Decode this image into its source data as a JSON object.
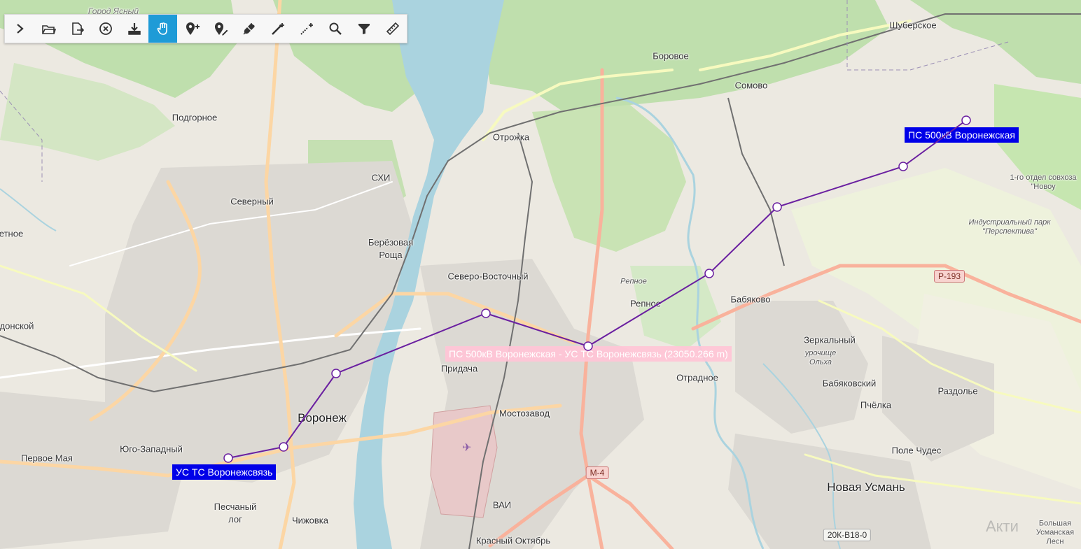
{
  "toolbar": {
    "buttons": [
      {
        "name": "expand",
        "icon": "chevron-right-icon"
      },
      {
        "name": "open-file",
        "icon": "folder-open-icon"
      },
      {
        "name": "export-file",
        "icon": "file-export-icon"
      },
      {
        "name": "clear",
        "icon": "close-circle-icon"
      },
      {
        "name": "download",
        "icon": "download-icon"
      },
      {
        "name": "pan",
        "icon": "hand-icon",
        "active": true
      },
      {
        "name": "add-point",
        "icon": "marker-add-icon"
      },
      {
        "name": "edit-point",
        "icon": "marker-edit-icon"
      },
      {
        "name": "connect",
        "icon": "plug-icon"
      },
      {
        "name": "add-line",
        "icon": "line-add-icon"
      },
      {
        "name": "edit-line",
        "icon": "line-edit-icon"
      },
      {
        "name": "search",
        "icon": "search-icon"
      },
      {
        "name": "filter",
        "icon": "filter-icon"
      },
      {
        "name": "measure",
        "icon": "ruler-icon"
      }
    ],
    "active_color": "#1e9bd7"
  },
  "stations": {
    "start": "УС ТС Воронежсвязь",
    "end": "ПС 500кВ Воронежская"
  },
  "route": {
    "label": "ПС 500кВ Воронежская - УС ТС Воронежсвязь  (23050.266 m)",
    "color": "#6a1fa0"
  },
  "places": {
    "voronezh": "Воронеж",
    "gorod_yasny": "Город Ясный",
    "podgornoe": "Подгорное",
    "severny": "Северный",
    "shi": "СХИ",
    "berezovaya_roscha": "Берёзовая Роща",
    "otrozhka": "Отрожка",
    "borovoe": "Боровое",
    "somovo": "Сомово",
    "shuberskoe": "Шуберское",
    "severo_vostochny": "Северо-Восточный",
    "repnoe": "Репное",
    "repnoe_small": "Репное",
    "babyakovo": "Бабяково",
    "pridacha": "Придача",
    "mostozavod": "Мостозавод",
    "otradnoe": "Отрадное",
    "zerkalny": "Зеркальный",
    "urochische_olha": "урочище Ольха",
    "babyakovsky": "Бабяковский",
    "pchelka": "Пчёлка",
    "razdolye": "Раздолье",
    "pole_chudes": "Поле Чудес",
    "novaya_usman": "Новая Усмань",
    "yugo_zapadny": "Юго-Западный",
    "pervoe_maya": "Первое Мая",
    "peschany_log": "Песчаный лог",
    "chizhovka": "Чижовка",
    "vai": "ВАИ",
    "krasny_oktyabr": "Красный Октябрь",
    "industrial_park": "Индустриальный парк \"Перспектива\"",
    "sovhoz": "1-го отдел совхоза \"Новоу",
    "etnoe": "етное",
    "donskoy": "донской",
    "bolshaya_usmanskaya": "Большая Усманская Лесн"
  },
  "roads": {
    "r193": "Р-193",
    "m4": "М-4",
    "r20k": "20К-В18-0"
  },
  "watermark": "Акти"
}
